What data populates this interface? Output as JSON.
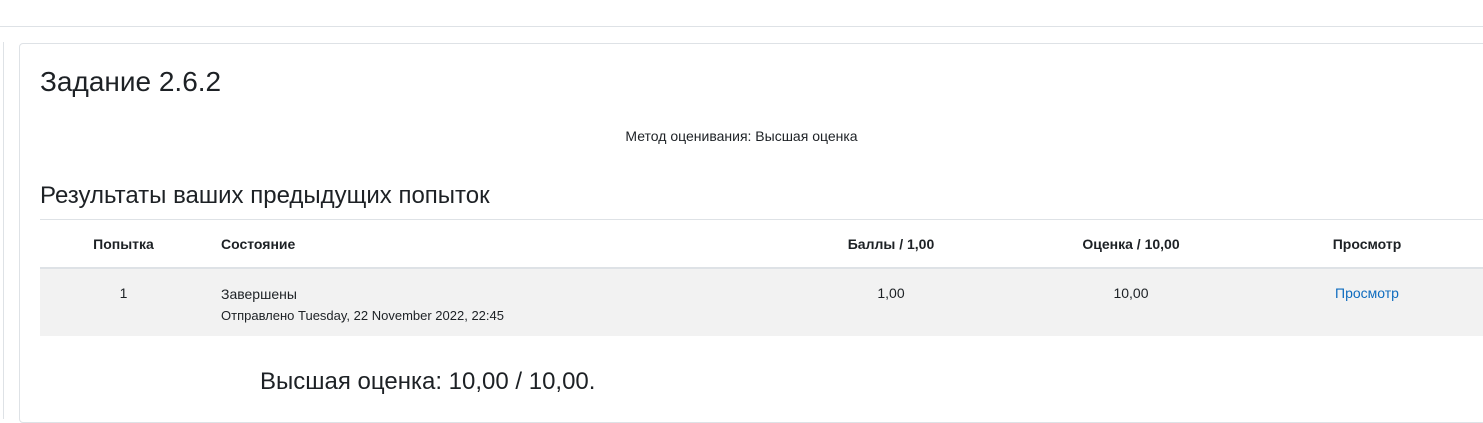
{
  "quiz": {
    "title": "Задание 2.6.2",
    "grading_method": "Метод оценивания: Высшая оценка"
  },
  "summary": {
    "heading": "Результаты ваших предыдущих попыток",
    "columns": {
      "attempt": "Попытка",
      "state": "Состояние",
      "marks": "Баллы / 1,00",
      "grade": "Оценка / 10,00",
      "review": "Просмотр"
    },
    "rows": [
      {
        "attempt": "1",
        "state": "Завершены",
        "submitted": "Отправлено Tuesday, 22 November 2022, 22:45",
        "marks": "1,00",
        "grade": "10,00",
        "review": "Просмотр"
      }
    ]
  },
  "feedback": {
    "highest_grade": "Высшая оценка: 10,00 / 10,00."
  },
  "colors": {
    "link": "#0f6cbf",
    "row_background": "#f2f2f2",
    "border": "#dee2e6",
    "text": "#1d2125"
  }
}
